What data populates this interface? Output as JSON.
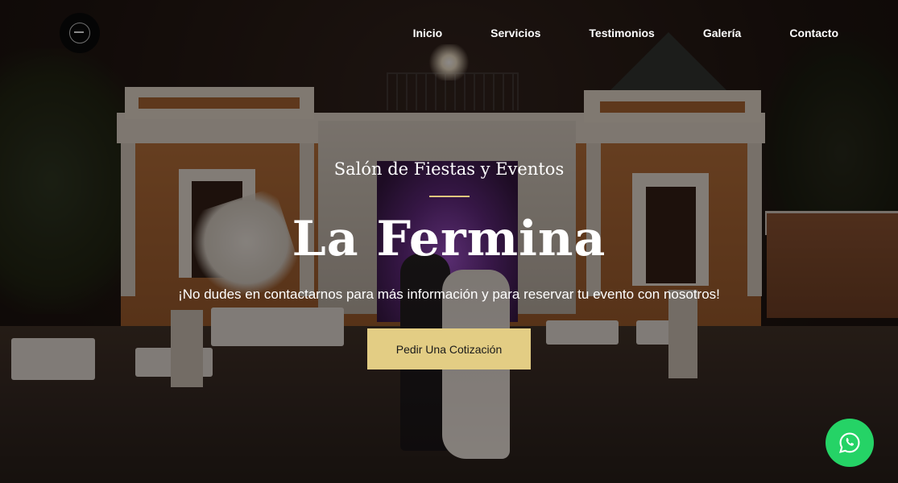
{
  "brand": {
    "logo_icon": "venue-logo-icon"
  },
  "nav": {
    "items": [
      {
        "label": "Inicio"
      },
      {
        "label": "Servicios"
      },
      {
        "label": "Testimonios"
      },
      {
        "label": "Galería"
      },
      {
        "label": "Contacto"
      }
    ]
  },
  "hero": {
    "subtitle": "Salón de Fiestas y Eventos",
    "title": "La Fermina",
    "tagline": "¡No dudes en contactarnos para más información y para reservar tu evento con nosotros!",
    "cta_label": "Pedir Una Cotización"
  },
  "floating": {
    "whatsapp_icon": "whatsapp-icon"
  },
  "colors": {
    "accent": "#e3cd84",
    "divider": "#e0c77d",
    "whatsapp": "#25d366",
    "overlay": "rgba(15,9,6,0.48)"
  }
}
